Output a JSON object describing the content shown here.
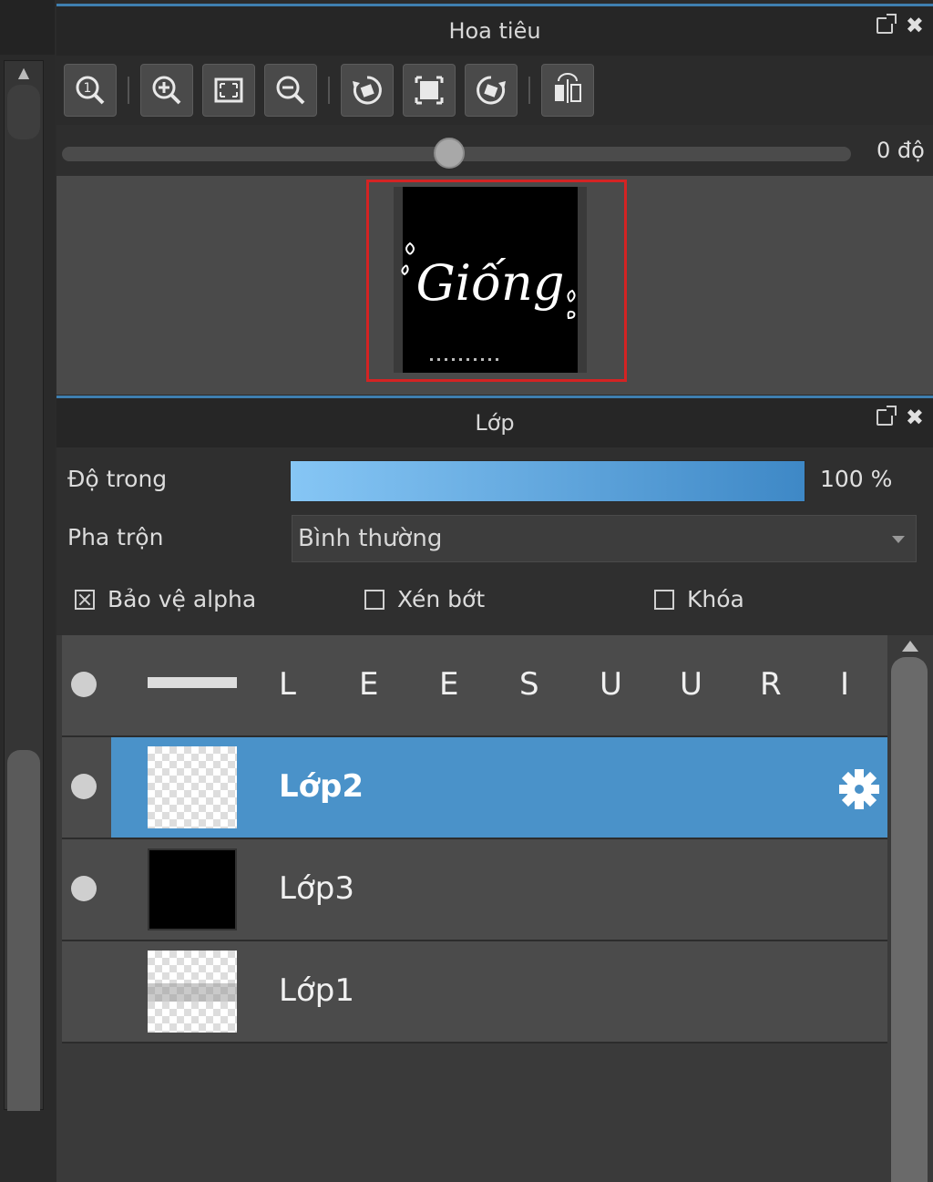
{
  "navigator": {
    "title": "Hoa tiêu",
    "rotation_value": "0 độ",
    "rotation_fraction": 0.5,
    "tools": [
      "zoom-actual-icon",
      "zoom-in-icon",
      "fit-window-icon",
      "zoom-out-icon",
      "rotate-left-icon",
      "reset-rotation-icon",
      "rotate-right-icon",
      "flip-horizontal-icon"
    ],
    "preview_text": "Giống"
  },
  "layer_panel": {
    "title": "Lớp",
    "opacity_label": "Độ trong",
    "opacity_value": "100 %",
    "opacity_fraction": 1.0,
    "blend_label": "Pha trộn",
    "blend_value": "Bình thường",
    "checkboxes": {
      "protect_alpha": {
        "label": "Bảo vệ alpha",
        "checked": true
      },
      "clipping": {
        "label": "Xén bớt",
        "checked": false
      },
      "lock": {
        "label": "Khóa",
        "checked": false
      }
    },
    "layers": [
      {
        "name_letters": [
          "L",
          "E",
          "E",
          "S",
          "U",
          "U",
          "R",
          "I"
        ],
        "visible": true,
        "selected": false
      },
      {
        "name": "Lớp2",
        "visible": true,
        "selected": true
      },
      {
        "name": "Lớp3",
        "visible": true,
        "selected": false
      },
      {
        "name": "Lớp1",
        "visible": false,
        "selected": false
      }
    ]
  },
  "colors": {
    "accent": "#4a92c9",
    "frame": "#d42323"
  }
}
